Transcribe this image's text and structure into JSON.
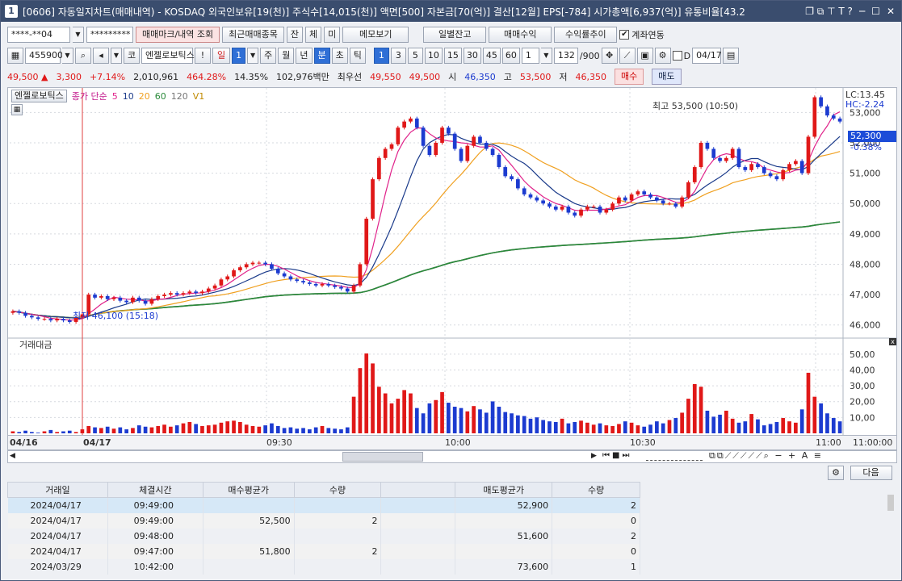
{
  "title": {
    "screen_no": "1",
    "text": "[0606] 자동일지차트(매매내역) - KOSDAQ 외국인보유[19(천)] 주식수[14,015(천)] 액면[500] 자본금[70(억)] 결산[12월] EPS[-784] 시가총액[6,937(억)] 유통비율[43.2"
  },
  "toolbar1": {
    "account": "****-**04",
    "password": "*********",
    "marks_button": "매매마크/내역 조회",
    "recent_button": "최근매매종목",
    "jan": "잔",
    "che": "체",
    "mi": "미",
    "memo_button": "메모보기",
    "daily_balance": "일별잔고",
    "trade_profit": "매매수익",
    "return_trend": "수익률추이",
    "account_link_label": "계좌연동",
    "account_link_check": "✔"
  },
  "toolbar2": {
    "code": "455900",
    "market_badge": "코",
    "stock_name": "엔젤로보틱스",
    "exclaim": "!",
    "period_il": "일",
    "period_num": "1",
    "periods": [
      "주",
      "월",
      "년"
    ],
    "minute": "분",
    "second": "초",
    "tick": "틱",
    "intervals": [
      "1",
      "3",
      "5",
      "10",
      "15",
      "30",
      "45",
      "60"
    ],
    "interval_select": "1",
    "count": "132",
    "count_total": "/900",
    "d_label": "D",
    "date": "04/17"
  },
  "quote": {
    "price": "49,500",
    "arrow": "▲",
    "change": "3,300",
    "change_pct": "+7.14%",
    "volume": "2,010,961",
    "volume_ratio": "464.28%",
    "turnover": "14.35%",
    "amount": "102,976백만",
    "best_quote_label": "최우선",
    "ask": "49,550",
    "bid": "49,500",
    "open_label": "시",
    "open": "46,350",
    "high_label": "고",
    "high": "53,500",
    "low_label": "저",
    "low": "46,350",
    "buy_button": "매수",
    "sell_button": "매도"
  },
  "price_chart": {
    "stock_label": "엔젤로보틱스",
    "ma_title": "종가 단순",
    "ma_periods": [
      "5",
      "10",
      "20",
      "60",
      "120"
    ],
    "ma_colors": [
      "#e0228a",
      "#1a3a8a",
      "#f0a020",
      "#2a8a3a",
      "#666666"
    ],
    "vol_ma_label": "V1",
    "lc": "LC:13.45",
    "hc": "HC:-2.24",
    "current_price": "52,300",
    "current_pct": "-0.38%",
    "high_annotation": "최고 53,500 (10:50)",
    "low_annotation": "최저 46,100 (15:18)",
    "y_ticks": [
      "53,000",
      "52,000",
      "51,000",
      "50,000",
      "49,000",
      "48,000",
      "47,000",
      "46,000"
    ]
  },
  "volume_chart": {
    "label": "거래대금",
    "y_ticks": [
      "50,00",
      "40,00",
      "30,00",
      "20,00",
      "10,00"
    ]
  },
  "x_axis": {
    "labels": [
      "04/16",
      "04/17",
      "09:30",
      "10:00",
      "10:30",
      "11:00"
    ],
    "cursor_time": "11:00:00"
  },
  "bottom_bar": {
    "next_button": "다음"
  },
  "trade_table": {
    "headers": [
      "거래일",
      "체결시간",
      "매수평균가",
      "수량",
      "",
      "매도평균가",
      "수량"
    ],
    "rows": [
      [
        "2024/04/17",
        "09:49:00",
        "",
        "",
        "",
        "52,900",
        "2"
      ],
      [
        "2024/04/17",
        "09:49:00",
        "52,500",
        "2",
        "",
        "",
        "0"
      ],
      [
        "2024/04/17",
        "09:48:00",
        "",
        "",
        "",
        "51,600",
        "2"
      ],
      [
        "2024/04/17",
        "09:47:00",
        "51,800",
        "2",
        "",
        "",
        "0"
      ],
      [
        "2024/03/29",
        "10:42:00",
        "",
        "",
        "",
        "73,600",
        "1"
      ]
    ]
  },
  "chart_data": {
    "type": "candlestick",
    "ylim": [
      45700,
      53700
    ],
    "x_labels": [
      "04/16",
      "04/17",
      "09:30",
      "10:00",
      "10:30",
      "11:00"
    ],
    "close": [
      46450,
      46400,
      46300,
      46250,
      46200,
      46200,
      46150,
      46200,
      46150,
      46100,
      46250,
      46350,
      47000,
      46900,
      46950,
      46850,
      46900,
      46800,
      46750,
      46900,
      46800,
      46700,
      46850,
      46950,
      47000,
      47050,
      47000,
      47050,
      47100,
      47050,
      47100,
      47200,
      47300,
      47500,
      47600,
      47800,
      47900,
      48000,
      48050,
      48050,
      48000,
      47850,
      47700,
      47600,
      47500,
      47450,
      47400,
      47350,
      47300,
      47350,
      47300,
      47250,
      47200,
      47100,
      47300,
      48000,
      49500,
      50800,
      51500,
      51800,
      51950,
      52500,
      52700,
      52800,
      52500,
      51900,
      51600,
      52000,
      52500,
      52300,
      51800,
      51400,
      51900,
      52200,
      52000,
      51800,
      51600,
      51200,
      50900,
      50800,
      50500,
      50300,
      50200,
      50100,
      50000,
      49900,
      49800,
      49900,
      49700,
      49600,
      49800,
      49900,
      49900,
      49700,
      49800,
      50000,
      50200,
      50100,
      50300,
      50400,
      50300,
      50200,
      50100,
      50000,
      50000,
      49900,
      50200,
      50700,
      51200,
      52000,
      51800,
      51500,
      51400,
      51500,
      51800,
      51200,
      51100,
      51300,
      51200,
      51000,
      50900,
      50800,
      51100,
      51300,
      51400,
      51000,
      52200,
      53500,
      53200,
      52900,
      52800,
      52700
    ],
    "volume_amount": [
      0.3,
      0.2,
      0.4,
      0.2,
      0.1,
      0.3,
      0.5,
      0.2,
      0.3,
      0.4,
      0.2,
      0.6,
      1.1,
      0.9,
      0.8,
      1.0,
      0.7,
      0.9,
      0.6,
      0.8,
      1.2,
      1.0,
      0.9,
      1.1,
      1.3,
      1.0,
      1.2,
      1.5,
      1.7,
      1.4,
      1.1,
      1.2,
      1.3,
      1.6,
      1.8,
      1.9,
      1.7,
      1.3,
      1.1,
      1.0,
      1.2,
      1.5,
      1.1,
      0.8,
      0.9,
      0.7,
      0.8,
      0.6,
      0.9,
      1.1,
      0.8,
      0.7,
      0.6,
      0.9,
      5.5,
      9.8,
      12.0,
      10.5,
      7.0,
      6.0,
      4.5,
      5.2,
      6.5,
      6.0,
      3.8,
      3.0,
      4.5,
      5.0,
      6.2,
      4.6,
      4.0,
      3.8,
      3.3,
      4.1,
      3.6,
      3.1,
      4.8,
      4.0,
      3.2,
      3.0,
      2.7,
      2.6,
      2.2,
      2.4,
      2.0,
      1.8,
      1.7,
      2.2,
      1.5,
      1.7,
      1.9,
      1.6,
      1.3,
      1.5,
      1.2,
      1.1,
      1.4,
      1.8,
      1.6,
      1.2,
      1.0,
      1.3,
      1.8,
      1.5,
      2.0,
      2.3,
      3.1,
      5.2,
      7.4,
      7.0,
      3.4,
      2.5,
      2.8,
      3.4,
      2.2,
      1.6,
      1.8,
      2.9,
      2.1,
      1.2,
      1.4,
      1.7,
      2.3,
      1.8,
      1.6,
      3.6,
      9.1,
      5.5,
      4.5,
      3.0,
      2.3,
      1.8
    ]
  }
}
